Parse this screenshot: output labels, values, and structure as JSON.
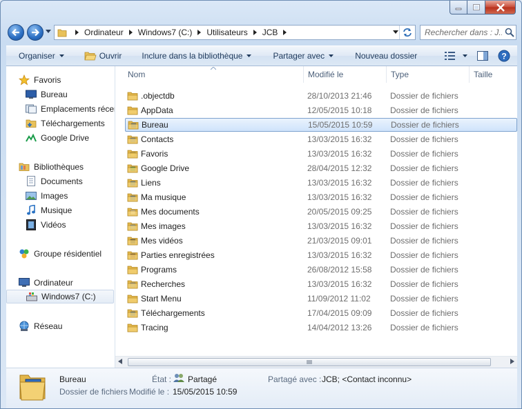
{
  "address": {
    "crumbs": [
      "Ordinateur",
      "Windows7 (C:)",
      "Utilisateurs",
      "JCB"
    ]
  },
  "search": {
    "placeholder": "Rechercher dans : J..."
  },
  "toolbar": {
    "organize": "Organiser",
    "open": "Ouvrir",
    "include": "Inclure dans la bibliothèque",
    "share": "Partager avec",
    "new_folder": "Nouveau dossier"
  },
  "nav": {
    "favorites": "Favoris",
    "fav_items": [
      "Bureau",
      "Emplacements récents",
      "Téléchargements",
      "Google Drive"
    ],
    "libraries": "Bibliothèques",
    "lib_items": [
      "Documents",
      "Images",
      "Musique",
      "Vidéos"
    ],
    "homegroup": "Groupe résidentiel",
    "computer": "Ordinateur",
    "computer_items": [
      "Windows7 (C:)"
    ],
    "network": "Réseau"
  },
  "columns": {
    "name": "Nom",
    "modified": "Modifié le",
    "type": "Type",
    "size": "Taille"
  },
  "files": [
    {
      "name": ".objectdb",
      "date": "28/10/2013 21:46",
      "type": "Dossier de fichiers",
      "icon": "folder-icon"
    },
    {
      "name": "AppData",
      "date": "12/05/2015 10:18",
      "type": "Dossier de fichiers",
      "icon": "folder-icon"
    },
    {
      "name": "Bureau",
      "date": "15/05/2015 10:59",
      "type": "Dossier de fichiers",
      "icon": "desktop-folder-icon"
    },
    {
      "name": "Contacts",
      "date": "13/03/2015 16:32",
      "type": "Dossier de fichiers",
      "icon": "contacts-folder-icon"
    },
    {
      "name": "Favoris",
      "date": "13/03/2015 16:32",
      "type": "Dossier de fichiers",
      "icon": "favorites-folder-icon"
    },
    {
      "name": "Google Drive",
      "date": "28/04/2015 12:32",
      "type": "Dossier de fichiers",
      "icon": "google-drive-folder-icon"
    },
    {
      "name": "Liens",
      "date": "13/03/2015 16:32",
      "type": "Dossier de fichiers",
      "icon": "links-folder-icon"
    },
    {
      "name": "Ma musique",
      "date": "13/03/2015 16:32",
      "type": "Dossier de fichiers",
      "icon": "music-folder-icon"
    },
    {
      "name": "Mes documents",
      "date": "20/05/2015 09:25",
      "type": "Dossier de fichiers",
      "icon": "documents-folder-icon"
    },
    {
      "name": "Mes images",
      "date": "13/03/2015 16:32",
      "type": "Dossier de fichiers",
      "icon": "pictures-folder-icon"
    },
    {
      "name": "Mes vidéos",
      "date": "21/03/2015 09:01",
      "type": "Dossier de fichiers",
      "icon": "videos-folder-icon"
    },
    {
      "name": "Parties enregistrées",
      "date": "13/03/2015 16:32",
      "type": "Dossier de fichiers",
      "icon": "saved-games-folder-icon"
    },
    {
      "name": "Programs",
      "date": "26/08/2012 15:58",
      "type": "Dossier de fichiers",
      "icon": "folder-icon"
    },
    {
      "name": "Recherches",
      "date": "13/03/2015 16:32",
      "type": "Dossier de fichiers",
      "icon": "searches-folder-icon"
    },
    {
      "name": "Start Menu",
      "date": "11/09/2012 11:02",
      "type": "Dossier de fichiers",
      "icon": "folder-icon"
    },
    {
      "name": "Téléchargements",
      "date": "17/04/2015 09:09",
      "type": "Dossier de fichiers",
      "icon": "downloads-folder-icon"
    },
    {
      "name": "Tracing",
      "date": "14/04/2012 13:26",
      "type": "Dossier de fichiers",
      "icon": "folder-icon"
    }
  ],
  "selected_file": "Bureau",
  "details": {
    "name": "Bureau",
    "type": "Dossier de fichiers",
    "state_label": "État :",
    "state_value": "Partagé",
    "modified_label": "Modifié le :",
    "modified_value": "15/05/2015 10:59",
    "shared_label": "Partagé avec :",
    "shared_value": "JCB; <Contact inconnu>"
  },
  "colors": {
    "selection": "#cfe3fb",
    "selection_border": "#7da2ce",
    "command_text": "#1e395b",
    "header_text": "#4c607a",
    "muted_text": "#6d6d6d"
  }
}
